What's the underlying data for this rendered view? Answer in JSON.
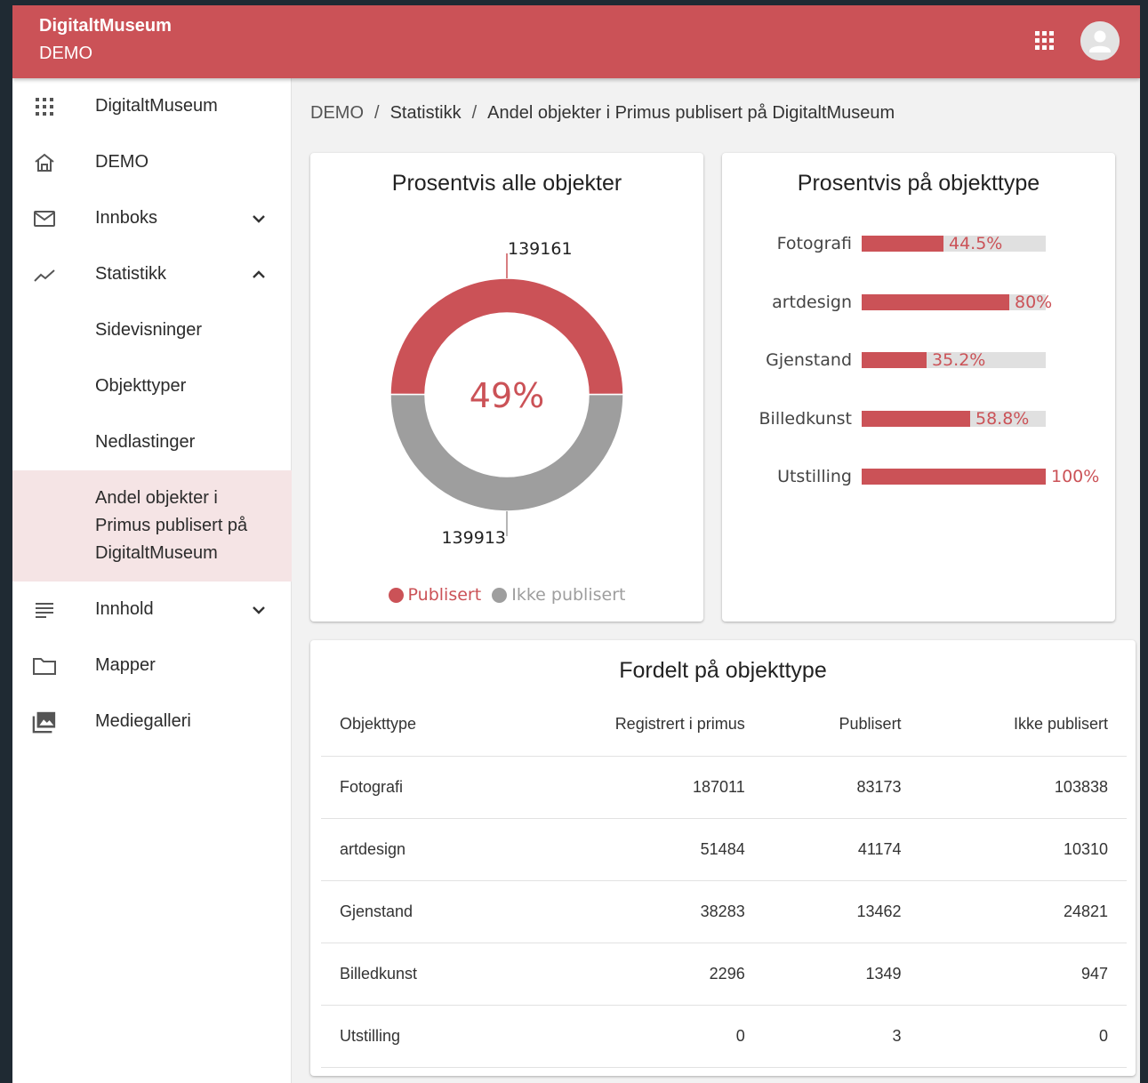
{
  "header": {
    "title": "DigitaltMuseum",
    "subtitle": "DEMO"
  },
  "sidebar": {
    "items": [
      {
        "label": "DigitaltMuseum",
        "icon": "apps-icon"
      },
      {
        "label": "DEMO",
        "icon": "home-icon"
      },
      {
        "label": "Innboks",
        "icon": "mail-icon",
        "chevron": "down"
      },
      {
        "label": "Statistikk",
        "icon": "trending-icon",
        "chevron": "up"
      },
      {
        "label": "Sidevisninger"
      },
      {
        "label": "Objekttyper"
      },
      {
        "label": "Nedlastinger"
      },
      {
        "label": "Andel objekter i Primus publisert på DigitaltMuseum",
        "active": true
      },
      {
        "label": "Innhold",
        "icon": "notes-icon",
        "chevron": "down"
      },
      {
        "label": "Mapper",
        "icon": "folder-icon"
      },
      {
        "label": "Mediegalleri",
        "icon": "photo-library-icon"
      }
    ]
  },
  "breadcrumb": [
    "DEMO",
    "Statistikk",
    "Andel objekter i Primus publisert på DigitaltMuseum"
  ],
  "colors": {
    "accent": "#cb5257",
    "grey": "#9e9e9e",
    "track": "#e0e0e0"
  },
  "donut_card": {
    "title": "Prosentvis alle objekter",
    "center_label": "49%",
    "top_label": "139161",
    "bottom_label": "139913",
    "legend": [
      "Publisert",
      "Ikke publisert"
    ]
  },
  "bars_card": {
    "title": "Prosentvis på objekttype"
  },
  "table_card": {
    "title": "Fordelt på objekttype",
    "columns": [
      "Objekttype",
      "Registrert i primus",
      "Publisert",
      "Ikke publisert"
    ],
    "rows": [
      [
        "Fotografi",
        "187011",
        "83173",
        "103838"
      ],
      [
        "artdesign",
        "51484",
        "41174",
        "10310"
      ],
      [
        "Gjenstand",
        "38283",
        "13462",
        "24821"
      ],
      [
        "Billedkunst",
        "2296",
        "1349",
        "947"
      ],
      [
        "Utstilling",
        "0",
        "3",
        "0"
      ]
    ]
  },
  "chart_data": [
    {
      "type": "pie",
      "title": "Prosentvis alle objekter",
      "series": [
        {
          "name": "Publisert",
          "value": 139161
        },
        {
          "name": "Ikke publisert",
          "value": 139913
        }
      ],
      "center_label": "49%",
      "legend": "bottom"
    },
    {
      "type": "bar",
      "title": "Prosentvis på objekttype",
      "categories": [
        "Fotografi",
        "artdesign",
        "Gjenstand",
        "Billedkunst",
        "Utstilling"
      ],
      "values": [
        44.5,
        80,
        35.2,
        58.8,
        100
      ],
      "value_labels": [
        "44.5%",
        "80%",
        "35.2%",
        "58.8%",
        "100%"
      ],
      "xlim": [
        0,
        100
      ]
    }
  ]
}
